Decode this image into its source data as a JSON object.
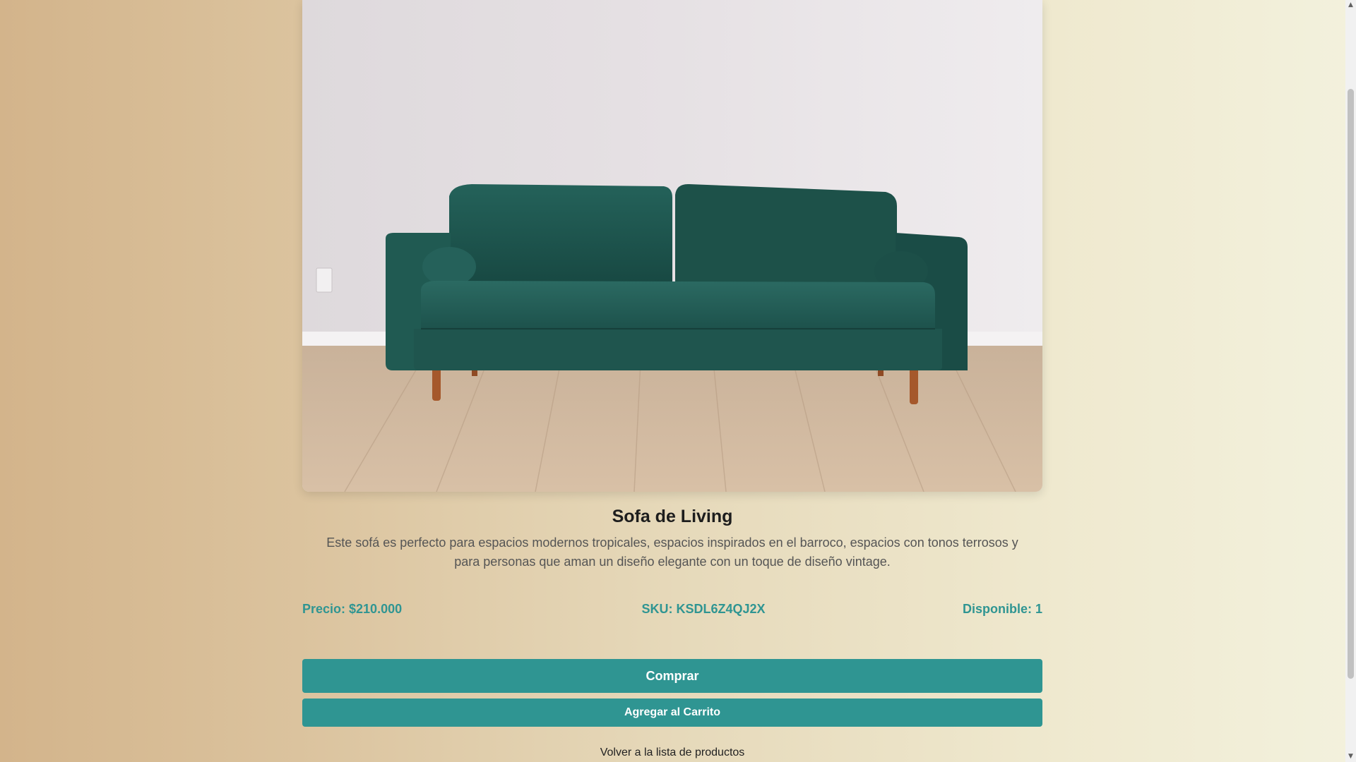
{
  "product": {
    "title": "Sofa de Living",
    "description": "Este sofá es perfecto para espacios modernos tropicales, espacios inspirados en el barroco, espacios con tonos terrosos y para personas que aman un diseño elegante con un toque de diseño vintage.",
    "price": "Precio: $210.000",
    "sku": "SKU: KSDL6Z4QJ2X",
    "available": "Disponible: 1",
    "image_alt": "green velvet sofa"
  },
  "actions": {
    "buy_label": "Comprar",
    "cart_label": "Agregar al Carrito",
    "back_label": "Volver a la lista de productos"
  },
  "colors": {
    "accent": "#2f9592",
    "sofa": "#1e5750"
  }
}
